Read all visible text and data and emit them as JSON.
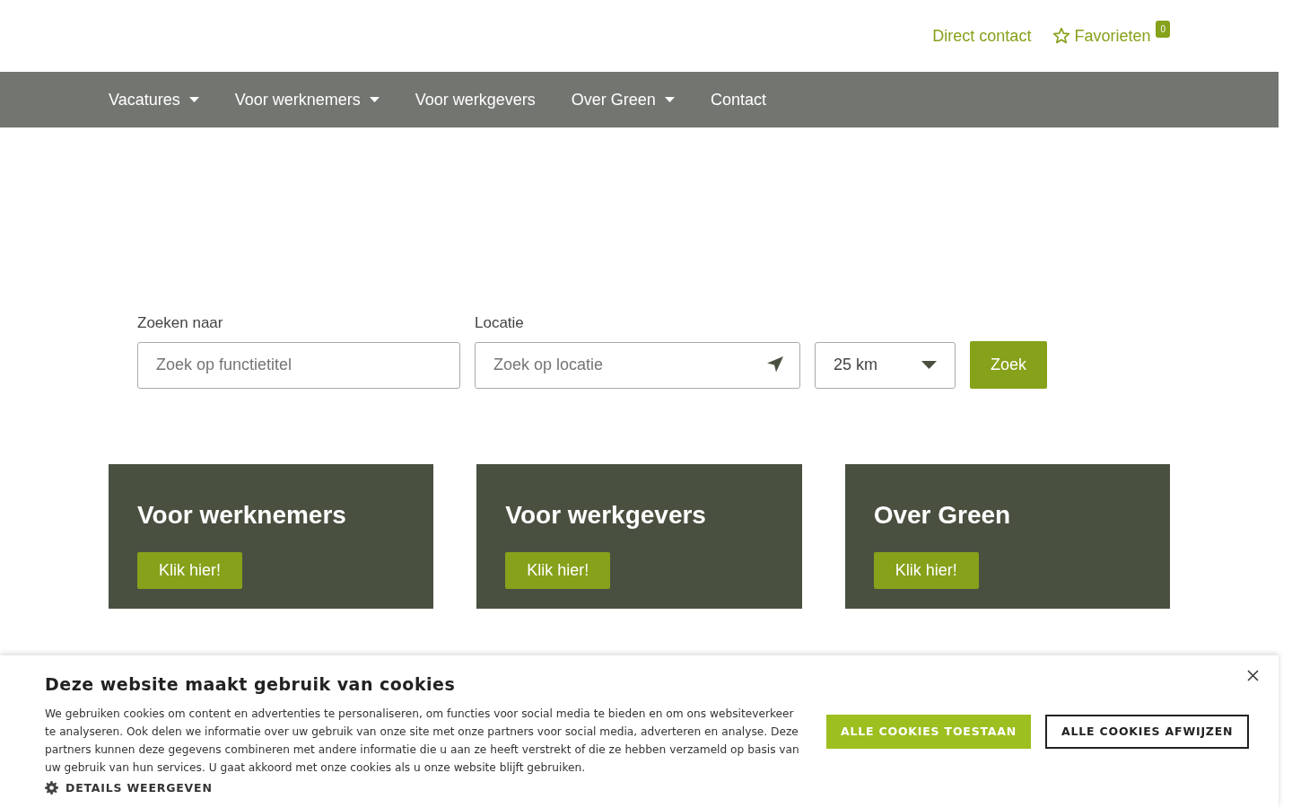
{
  "top_links": {
    "contact": "Direct contact",
    "favorites": "Favorieten",
    "favorites_count": "0"
  },
  "nav": [
    {
      "label": "Vacatures",
      "has_menu": true
    },
    {
      "label": "Voor werknemers",
      "has_menu": true
    },
    {
      "label": "Voor werkgevers",
      "has_menu": false
    },
    {
      "label": "Over Green",
      "has_menu": true
    },
    {
      "label": "Contact",
      "has_menu": false
    }
  ],
  "search": {
    "what_label": "Zoeken naar",
    "what_placeholder": "Zoek op functietitel",
    "location_label": "Locatie",
    "location_placeholder": "Zoek op locatie",
    "radius": "25 km",
    "button": "Zoek"
  },
  "cards": [
    {
      "title": "Voor werknemers",
      "button": "Klik hier!"
    },
    {
      "title": "Voor werkgevers",
      "button": "Klik hier!"
    },
    {
      "title": "Over Green",
      "button": "Klik hier!"
    }
  ],
  "cookie_banner": {
    "title": "Deze website maakt gebruik van cookies",
    "text": "We gebruiken cookies om content en advertenties te personaliseren, om functies voor social media te bieden en om ons websiteverkeer te analyseren. Ook delen we informatie over uw gebruik van onze site met onze partners voor social media, adverteren en analyse. Deze partners kunnen deze gegevens combineren met andere informatie die u aan ze heeft verstrekt of die ze hebben verzameld op basis van uw gebruik van hun services. U gaat akkoord met onze cookies als u onze website blijft gebruiken.",
    "details": "DETAILS WEERGEVEN",
    "accept": "ALLE COOKIES TOESTAAN",
    "reject": "ALLE COOKIES AFWIJZEN"
  }
}
